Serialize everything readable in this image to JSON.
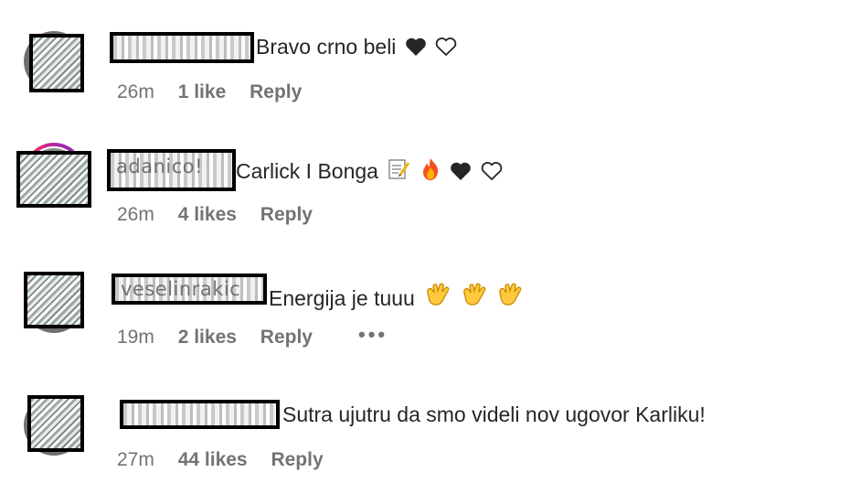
{
  "comments": [
    {
      "text": "Bravo crno beli",
      "emojis": [
        "black-heart",
        "white-heart"
      ],
      "time": "26m",
      "likes": "1 like",
      "reply": "Reply"
    },
    {
      "username_visible": "adanico!",
      "text": "Carlick I Bonga",
      "emojis": [
        "memo",
        "fire",
        "black-heart",
        "white-heart"
      ],
      "time": "26m",
      "likes": "4 likes",
      "reply": "Reply"
    },
    {
      "username_visible": "veselinrakic",
      "text": "Energija je tuuu",
      "emojis": [
        "clapping-hands",
        "clapping-hands",
        "clapping-hands"
      ],
      "time": "19m",
      "likes": "2 likes",
      "reply": "Reply",
      "more": "•••"
    },
    {
      "text": "Sutra ujutru da smo videli nov ugovor Karliku!",
      "emojis": [],
      "time": "27m",
      "likes": "44 likes",
      "reply": "Reply"
    }
  ],
  "colors": {
    "text": "#262626",
    "meta": "#737373",
    "censor_border": "#000000"
  }
}
